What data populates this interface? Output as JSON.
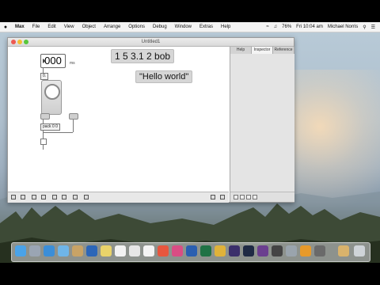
{
  "menubar": {
    "app_name": "Max",
    "items": [
      "File",
      "Edit",
      "View",
      "Object",
      "Arrange",
      "Options",
      "Debug",
      "Window",
      "Extras",
      "Help"
    ],
    "battery": "76%",
    "clock": "Fri 10:04 am",
    "user": "Michael Norris"
  },
  "window": {
    "title": "Untitled1",
    "sidebar_tabs": [
      "Help",
      "Inspector",
      "Reference"
    ],
    "sidebar_active": "Inspector"
  },
  "patcher": {
    "number_box_value": "000",
    "number_suffix": "ms",
    "small_obj_label": "0.",
    "pack_label": "pack 0 0",
    "message_1": "1 5 3.1 2 bob",
    "message_2": "\"Hello world\""
  },
  "colors": {
    "message_bg": "#d6d6d6",
    "traffic_red": "#ee5a52",
    "traffic_yellow": "#f5bd32",
    "traffic_green": "#59c73c"
  },
  "dock": {
    "icons": [
      "finder-icon",
      "launchpad-icon",
      "safari-icon",
      "mail-icon",
      "contacts-icon",
      "word-icon",
      "preview-icon",
      "notes-icon",
      "reminders-icon",
      "calendar-icon",
      "itunes-icon",
      "music-icon",
      "word-w-icon",
      "excel-icon",
      "chrome-icon",
      "eclipse-icon",
      "github-icon",
      "max-icon",
      "sublime-icon",
      "automator-icon",
      "pages-icon",
      "keynote-icon",
      "downloads-icon",
      "trash-icon"
    ]
  }
}
